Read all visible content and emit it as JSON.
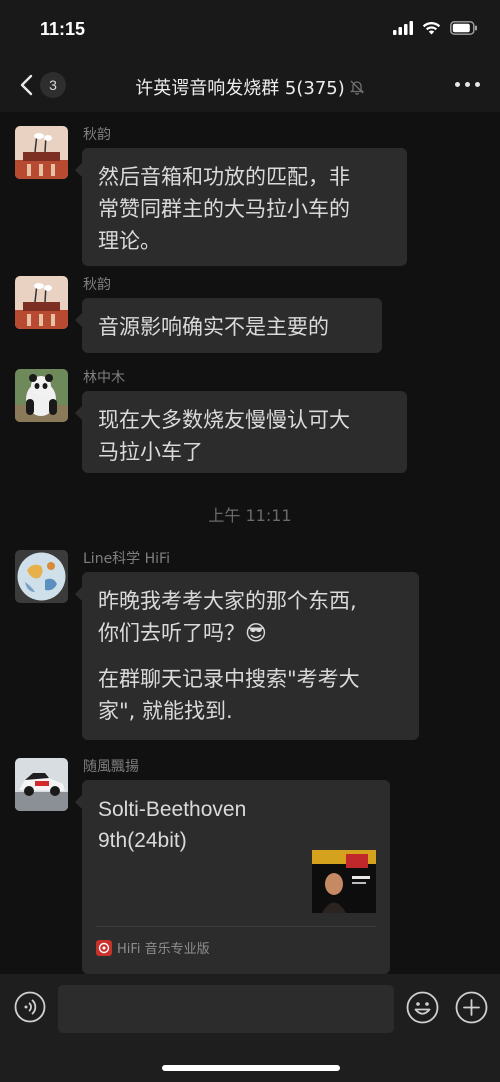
{
  "status_bar": {
    "time": "11:15"
  },
  "nav": {
    "unread_count": "3",
    "title": "许英谔音响发烧群 5(375)"
  },
  "messages": [
    {
      "sender": "秋韵",
      "lines": [
        "然后音箱和功放的匹配，非",
        "常赞同群主的大马拉小车的",
        "理论。"
      ]
    },
    {
      "sender": "秋韵",
      "lines": [
        "音源影响确实不是主要的"
      ]
    },
    {
      "sender": "林中木",
      "lines": [
        "现在大多数烧友慢慢认可大",
        "马拉小车了"
      ]
    },
    {
      "sender": "Line科学 HiFi",
      "lines": [
        "昨晚我考考大家的那个东西,",
        "你们去听了吗？😎",
        "",
        "在群聊天记录中搜索\"考考大",
        "家\", 就能找到."
      ]
    },
    {
      "sender": "随風飄揚",
      "card_title": "Solti-Beethoven 9th(24bit)",
      "card_source": "HiFi 音乐专业版"
    }
  ],
  "time_separator": "上午 11:11",
  "colors": {
    "background": "#111111",
    "bubble": "#2c2c2c",
    "bar": "#191919",
    "text": "#dadada"
  },
  "icons": [
    "back-chevron-icon",
    "mute-bell-icon",
    "more-dots-icon",
    "voice-icon",
    "emoji-icon",
    "plus-icon",
    "music-app-icon"
  ]
}
